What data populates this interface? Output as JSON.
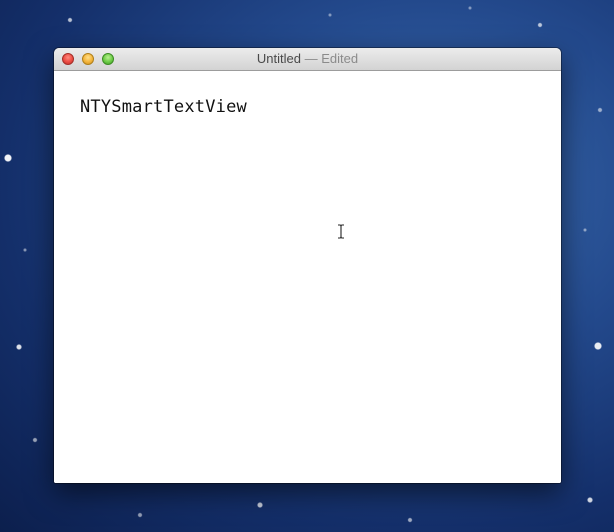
{
  "window": {
    "title": "Untitled",
    "separator": " — ",
    "state": "Edited"
  },
  "editor": {
    "content": "NTYSmartTextView"
  },
  "icons": {
    "close": "close-button-red",
    "minimize": "minimize-button-yellow",
    "zoom": "zoom-button-green",
    "cursor": "ibeam-cursor-icon"
  },
  "colors": {
    "close": "#ec4b42",
    "minimize": "#f4b43b",
    "zoom": "#6ccb46",
    "desktop": "#23498c"
  }
}
